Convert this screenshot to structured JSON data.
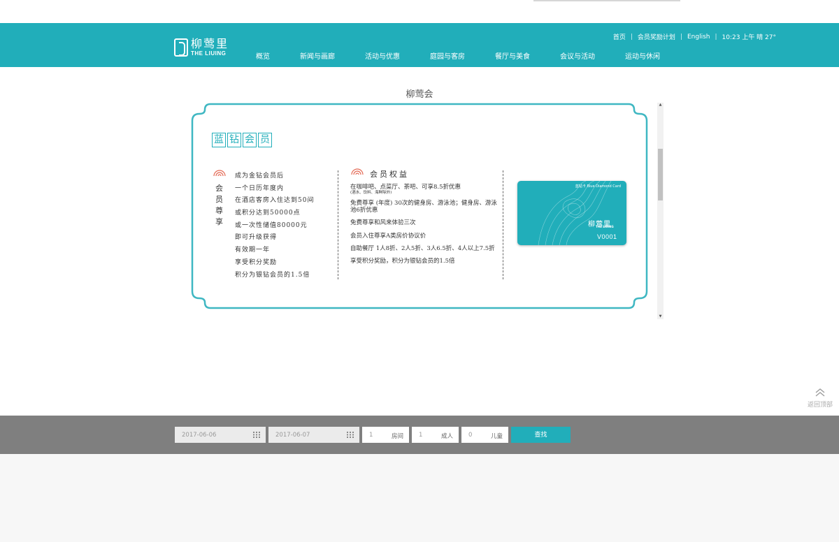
{
  "brand": {
    "name_cn": "柳莺里",
    "name_en": "THE LIUING"
  },
  "header": {
    "util_links": [
      "首页",
      "会员奖励计划",
      "English"
    ],
    "time_weather": "10:23 上午 晴 27°"
  },
  "nav": [
    "概览",
    "新闻与画廊",
    "活动与优惠",
    "庭园与客房",
    "餐厅与美食",
    "会议与活动",
    "运动与休闲"
  ],
  "page_title": "柳莺会",
  "membership": {
    "heading_chars": [
      "蓝",
      "钻",
      "会",
      "员"
    ],
    "col1_title": "会员尊享",
    "col1_items": [
      "成为金钻会员后",
      "一个日历年度内",
      "在酒店客房入住达到50间",
      "或积分达到50000点",
      "或一次性储值80000元",
      "即可升级获得",
      "有效期一年",
      "享受积分奖励",
      "积分为银钻会员的1.5倍"
    ],
    "col2_title": "会员权益",
    "col2_items": [
      {
        "text": "在咖啡吧、点菜厅、茶吧、可享8.5折优惠",
        "note": "(酒水、饮料、海鲜除外)"
      },
      {
        "text": "免费尊享 (年度) 30次的健身房、游泳池；健身房、游泳池6折优惠",
        "note": ""
      },
      {
        "text": "免费尊享和风来体验三次",
        "note": ""
      },
      {
        "text": "会员入住尊享A类房价协议价",
        "note": ""
      },
      {
        "text": "自助餐厅 1人8折、2人5折、3人6.5折、4人以上7.5折",
        "note": ""
      },
      {
        "text": "享受积分奖励，积分为银钻会员的1.5倍",
        "note": ""
      }
    ],
    "card": {
      "label": "蓝钻卡 Blue Diamond Card",
      "brand_cn": "柳莺里",
      "brand_en": "THE LIUING",
      "number": "V0001"
    }
  },
  "back_to_top": "返回顶部",
  "booking": {
    "checkin": "2017-06-06",
    "checkout": "2017-06-07",
    "rooms": {
      "value": "1",
      "unit": "房间"
    },
    "adults": {
      "value": "1",
      "unit": "成人"
    },
    "children": {
      "value": "0",
      "unit": "儿童"
    },
    "search_label": "查找"
  },
  "colors": {
    "brand": "#21aeba",
    "booking_bar": "#7f7f7f"
  }
}
